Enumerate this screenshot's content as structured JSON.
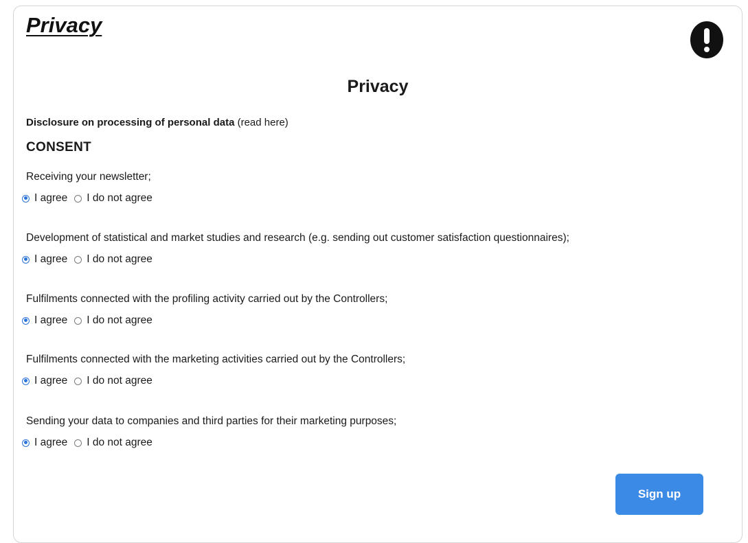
{
  "header": {
    "title": "Privacy",
    "alert_icon": "exclamation-circle-icon"
  },
  "main": {
    "title": "Privacy",
    "disclosure_bold": "Disclosure on processing of personal data",
    "disclosure_link": "(read here)",
    "consent_heading": "CONSENT",
    "items": [
      {
        "question": "Receiving your newsletter;",
        "agree": "I agree",
        "disagree": "I do not agree",
        "selected": "agree"
      },
      {
        "question": "Development of statistical and market studies and research (e.g. sending out customer satisfaction questionnaires);",
        "agree": "I agree",
        "disagree": "I do not agree",
        "selected": "agree"
      },
      {
        "question": "Fulfilments connected with the profiling activity carried out by the Controllers;",
        "agree": "I agree",
        "disagree": "I do not agree",
        "selected": "agree"
      },
      {
        "question": "Fulfilments connected with the marketing activities carried out by the Controllers;",
        "agree": "I agree",
        "disagree": "I do not agree",
        "selected": "agree"
      },
      {
        "question": "Sending your data to companies and third parties for their marketing purposes;",
        "agree": "I agree",
        "disagree": "I do not agree",
        "selected": "agree"
      }
    ],
    "signup_label": "Sign up"
  },
  "colors": {
    "accent": "#2a73d8",
    "button": "#3b8ae6",
    "border": "#d4d4d4"
  }
}
